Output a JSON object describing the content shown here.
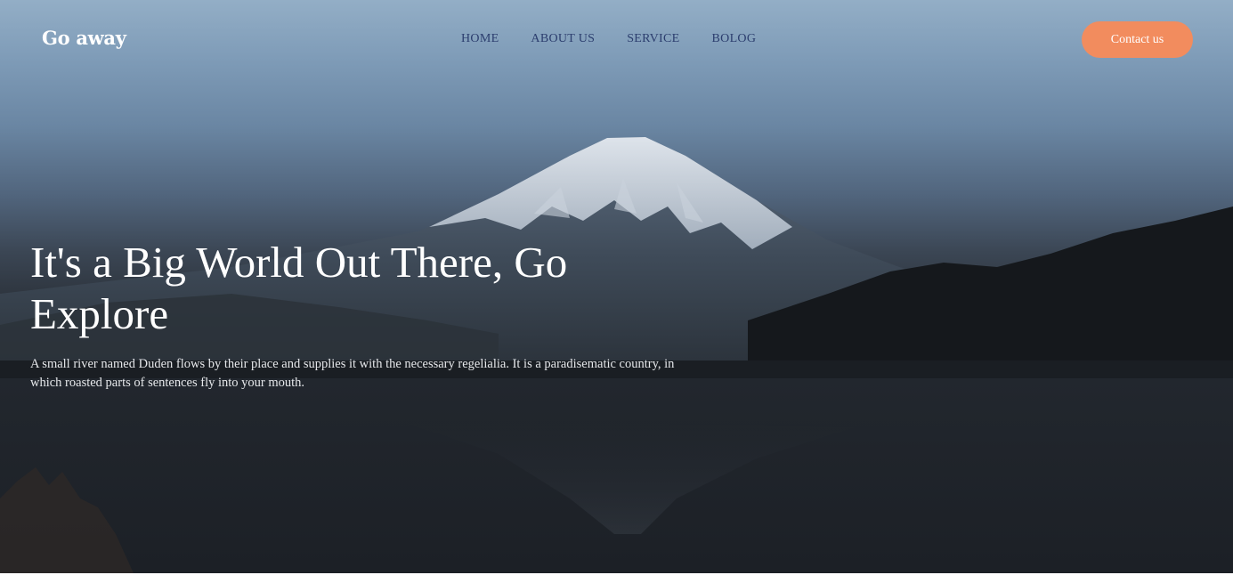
{
  "brand": {
    "logo_text": "Go away"
  },
  "nav": {
    "items": [
      {
        "label": "HOME"
      },
      {
        "label": "ABOUT US"
      },
      {
        "label": "SERVICE"
      },
      {
        "label": "BOLOG"
      }
    ]
  },
  "header": {
    "contact_label": "Contact us"
  },
  "hero": {
    "headline": "It's a Big World Out There, Go Explore",
    "lead": "A small river named Duden flows by their place and supplies it with the necessary regelialia. It is a paradisematic country, in which roasted parts of sentences fly into your mouth."
  },
  "colors": {
    "accent": "#f28c5e",
    "nav_text": "#2c3e6e",
    "sky_top": "#93aec6",
    "dark_ground": "#1b1f25"
  }
}
